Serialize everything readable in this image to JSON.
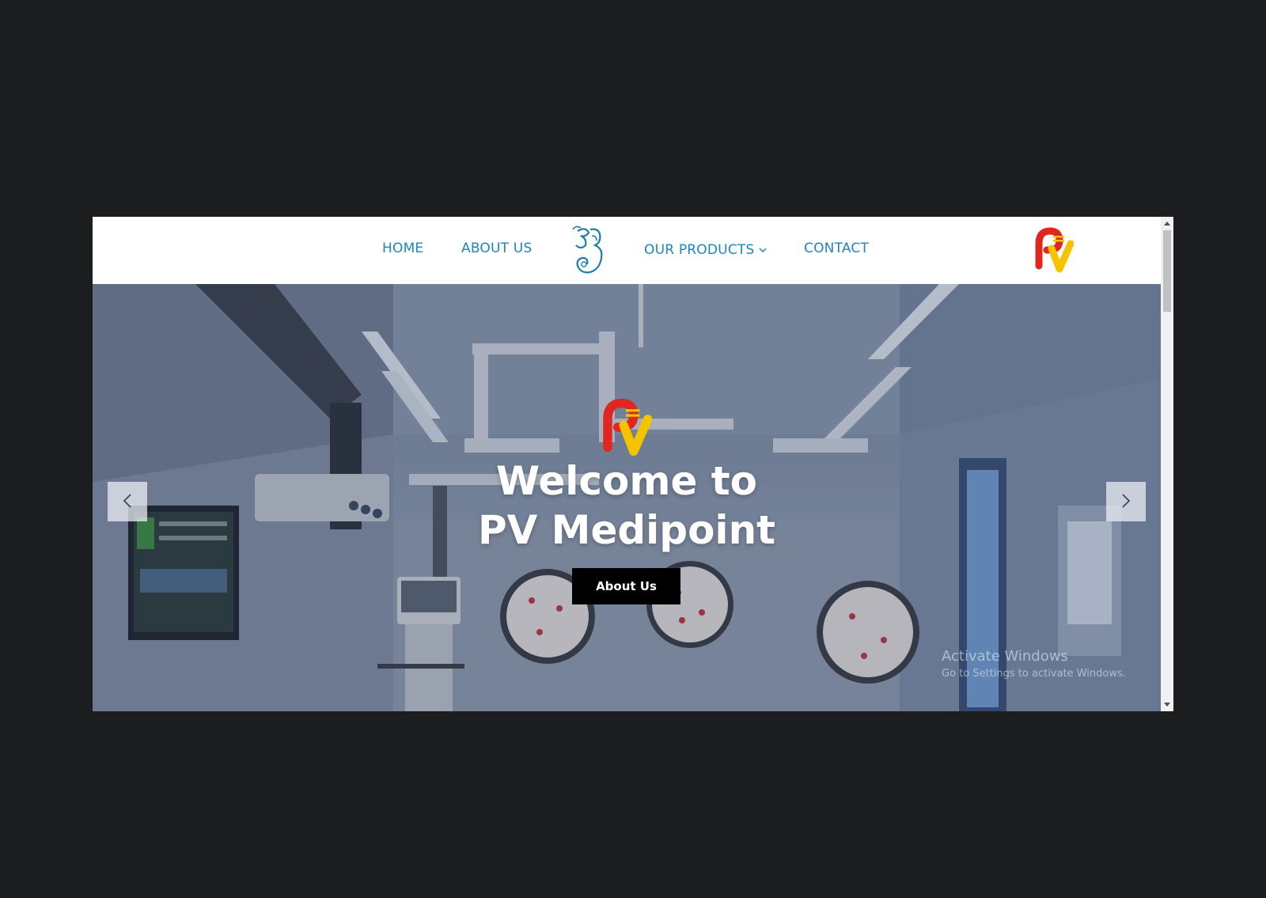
{
  "nav": {
    "home": "HOME",
    "about": "ABOUT US",
    "products": "OUR PRODUCTS",
    "contact": "CONTACT"
  },
  "icons": {
    "center_logo": "om-ganesha-logo",
    "brand_logo": "pv-logo",
    "products_dropdown": "chevron-down-icon",
    "prev": "chevron-left-icon",
    "next": "chevron-right-icon"
  },
  "hero": {
    "title_line1": "Welcome to",
    "title_line2": "PV Medipoint",
    "button_label": "About Us"
  },
  "watermark": {
    "title": "Activate Windows",
    "subtitle": "Go to Settings to activate Windows."
  },
  "colors": {
    "nav_link": "#1a87c4",
    "logo_red": "#e0261f",
    "logo_yellow": "#f6c300",
    "button_bg": "#000000",
    "page_bg": "#1c1d1f"
  }
}
